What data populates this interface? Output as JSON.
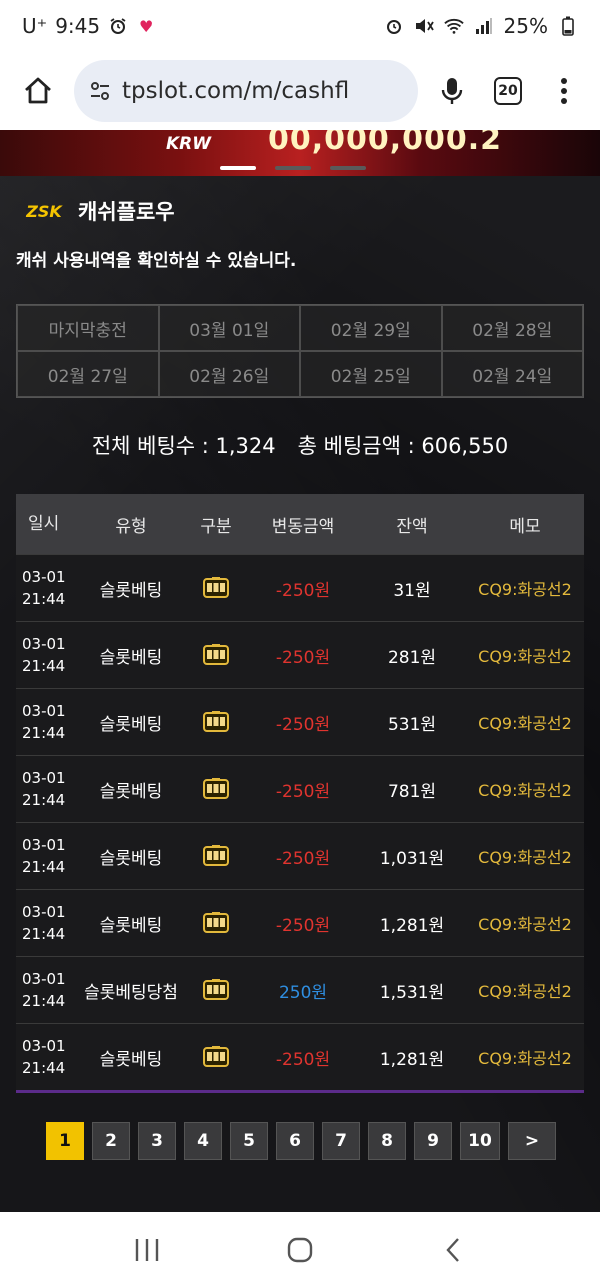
{
  "status_bar": {
    "carrier": "U⁺",
    "time": "9:45",
    "battery": "25%"
  },
  "browser": {
    "url": "tpslot.com/m/cashfl",
    "tab_count": "20"
  },
  "banner": {
    "currency": "KRW",
    "jackpot": "00,000,000.2"
  },
  "page": {
    "title": "캐쉬플로우",
    "subtitle": "캐쉬 사용내역을 확인하실 수 있습니다.",
    "logo_text": "ZSK"
  },
  "date_filters": [
    "마지막충전",
    "03월 01일",
    "02월 29일",
    "02월 28일",
    "02월 27일",
    "02월 26일",
    "02월 25일",
    "02월 24일"
  ],
  "totals": {
    "bet_count": "전체 베팅수 : 1,324",
    "bet_amount": "총 베팅금액 : 606,550"
  },
  "table": {
    "headers": [
      "일시",
      "유형",
      "구분",
      "변동금액",
      "잔액",
      "메모"
    ],
    "rows": [
      {
        "date": "03-01",
        "time": "21:44",
        "type": "슬롯베팅",
        "amount": "-250원",
        "balance": "31원",
        "memo": "CQ9:화공선2"
      },
      {
        "date": "03-01",
        "time": "21:44",
        "type": "슬롯베팅",
        "amount": "-250원",
        "balance": "281원",
        "memo": "CQ9:화공선2"
      },
      {
        "date": "03-01",
        "time": "21:44",
        "type": "슬롯베팅",
        "amount": "-250원",
        "balance": "531원",
        "memo": "CQ9:화공선2"
      },
      {
        "date": "03-01",
        "time": "21:44",
        "type": "슬롯베팅",
        "amount": "-250원",
        "balance": "781원",
        "memo": "CQ9:화공선2"
      },
      {
        "date": "03-01",
        "time": "21:44",
        "type": "슬롯베팅",
        "amount": "-250원",
        "balance": "1,031원",
        "memo": "CQ9:화공선2"
      },
      {
        "date": "03-01",
        "time": "21:44",
        "type": "슬롯베팅",
        "amount": "-250원",
        "balance": "1,281원",
        "memo": "CQ9:화공선2"
      },
      {
        "date": "03-01",
        "time": "21:44",
        "type": "슬롯베팅당첨",
        "amount": "250원",
        "balance": "1,531원",
        "memo": "CQ9:화공선2"
      },
      {
        "date": "03-01",
        "time": "21:44",
        "type": "슬롯베팅",
        "amount": "-250원",
        "balance": "1,281원",
        "memo": "CQ9:화공선2"
      }
    ]
  },
  "pagination": {
    "pages": [
      "1",
      "2",
      "3",
      "4",
      "5",
      "6",
      "7",
      "8",
      "9",
      "10"
    ],
    "current": "1",
    "next_label": ">"
  },
  "colors": {
    "negative": "#e0342f",
    "positive": "#2f8ee0",
    "memo": "#e3b93c",
    "active_page": "#f2c200"
  },
  "icons": {
    "category": "slot-machine-icon"
  }
}
